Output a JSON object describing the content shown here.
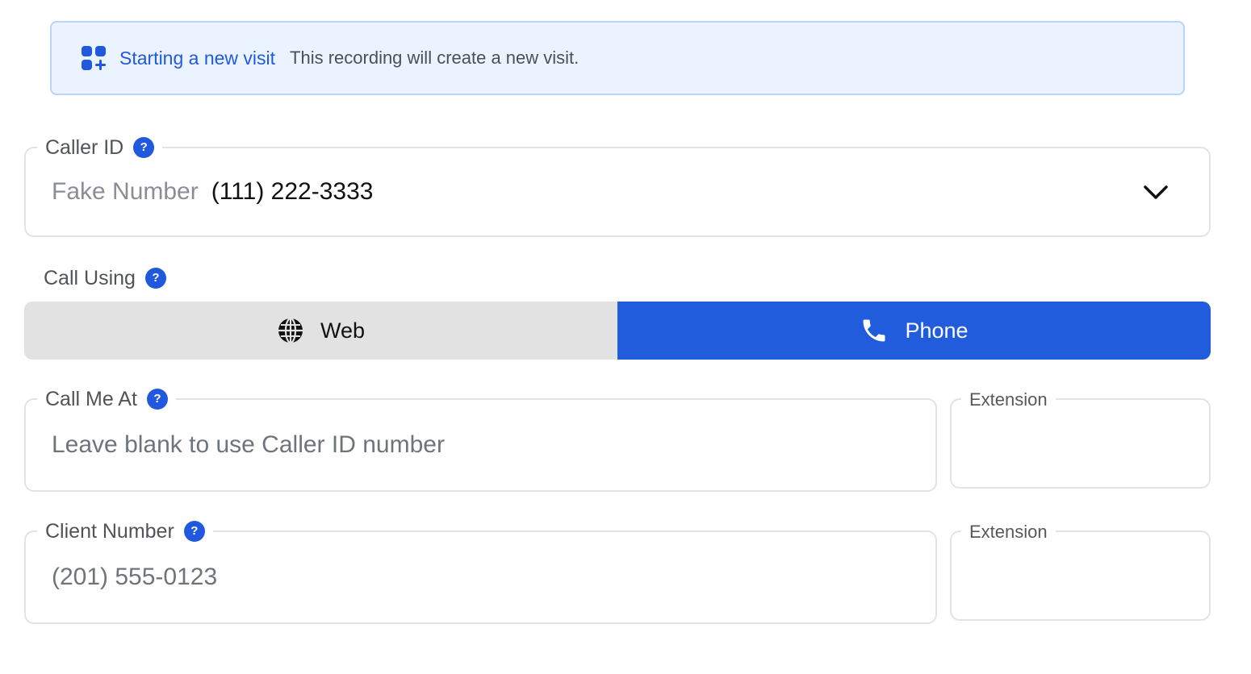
{
  "banner": {
    "title": "Starting a new visit",
    "text": "This recording will create a new visit.",
    "icon": "apps-add-icon"
  },
  "caller_id": {
    "label": "Caller ID",
    "help": "?",
    "name": "Fake Number",
    "number": "(111) 222-3333"
  },
  "call_using": {
    "label": "Call Using",
    "help": "?",
    "options": [
      {
        "label": "Web",
        "icon": "globe-icon",
        "selected": false
      },
      {
        "label": "Phone",
        "icon": "phone-icon",
        "selected": true
      }
    ]
  },
  "call_me_at": {
    "label": "Call Me At",
    "help": "?",
    "placeholder": "Leave blank to use Caller ID number",
    "extension_label": "Extension"
  },
  "client_number": {
    "label": "Client Number",
    "help": "?",
    "placeholder": "(201) 555-0123",
    "extension_label": "Extension"
  },
  "colors": {
    "accent": "#215cdd",
    "banner_bg": "#eaf3ff",
    "toggle_inactive": "#e2e2e2"
  }
}
